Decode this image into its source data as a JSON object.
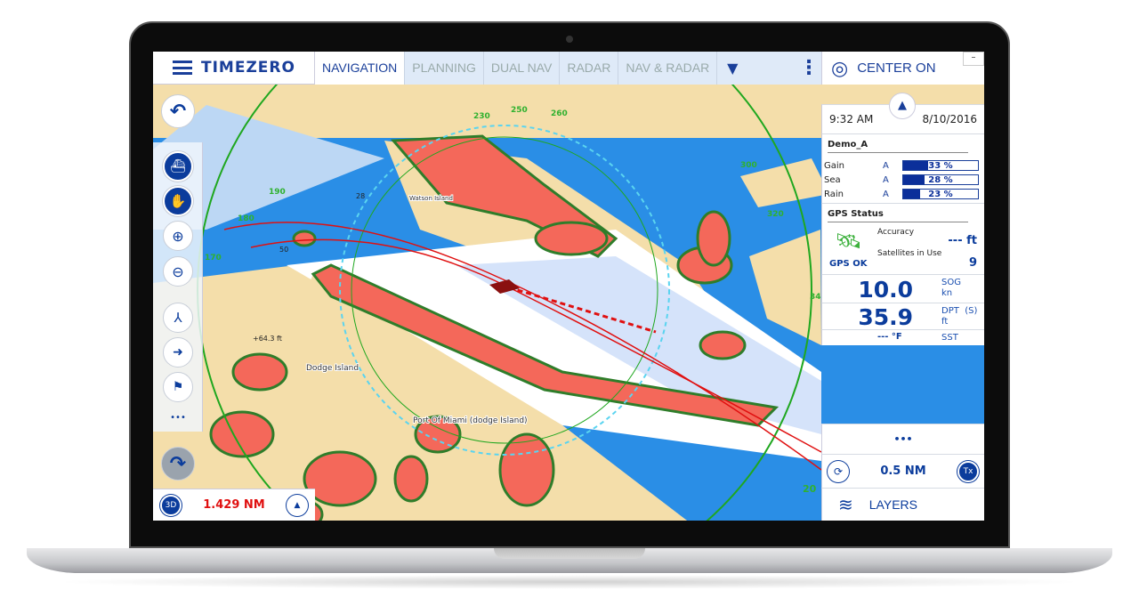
{
  "app": {
    "brand": "TIMEZERO"
  },
  "tabs": [
    {
      "label": "NAVIGATION",
      "active": true
    },
    {
      "label": "PLANNING"
    },
    {
      "label": "DUAL NAV"
    },
    {
      "label": "RADAR"
    },
    {
      "label": "NAV & RADAR"
    }
  ],
  "tab_more": "▼",
  "kebab": "⋮",
  "center_on": "CENTER ON",
  "minimize": "–",
  "time": "9:32 AM",
  "date": "8/10/2016",
  "radar": {
    "title": "Demo_A",
    "controls": [
      {
        "label": "Gain",
        "mode": "A",
        "value": "33 %",
        "level": 33
      },
      {
        "label": "Sea",
        "mode": "A",
        "value": "28 %",
        "level": 28
      },
      {
        "label": "Rain",
        "mode": "A",
        "value": "23 %",
        "level": 23
      }
    ]
  },
  "gps": {
    "title": "GPS Status",
    "status": "GPS OK",
    "accuracy_label": "Accuracy",
    "accuracy_value": "--- ft",
    "satellites_label": "Satellites in Use",
    "satellites_value": "9"
  },
  "sog": {
    "value": "10.0",
    "label": "SOG",
    "unit": "kn"
  },
  "dpt": {
    "value": "35.9",
    "label": "DPT  (S)",
    "unit": "ft"
  },
  "sst": {
    "value": "--- °F",
    "label": "SST"
  },
  "more_dots": "•••",
  "range": "0.5 NM",
  "tx": "Tx",
  "layers": "LAYERS",
  "bottom": {
    "mode3d": "3D",
    "distance": "1.429 NM"
  },
  "toolbar_more": "•••",
  "map_labels": {
    "dodge": "Dodge Island",
    "port": "Port Of Miami (dodge Island)",
    "watson": "Watson Island",
    "depth": "+64.3 ft",
    "r170": "170",
    "r180": "180",
    "r190": "190",
    "r20": "20",
    "r230": "230",
    "r250": "250",
    "r260": "260",
    "r300": "300",
    "r320": "320",
    "r340": "34",
    "d50": "50",
    "d28": "28"
  },
  "colors": {
    "accent": "#0b3c9c",
    "water": "#2a8ee6",
    "land": "#f4deaa",
    "echo": "#f4685a",
    "ring": "#1fa71f",
    "route": "#e01010",
    "distance": "#e01010"
  }
}
